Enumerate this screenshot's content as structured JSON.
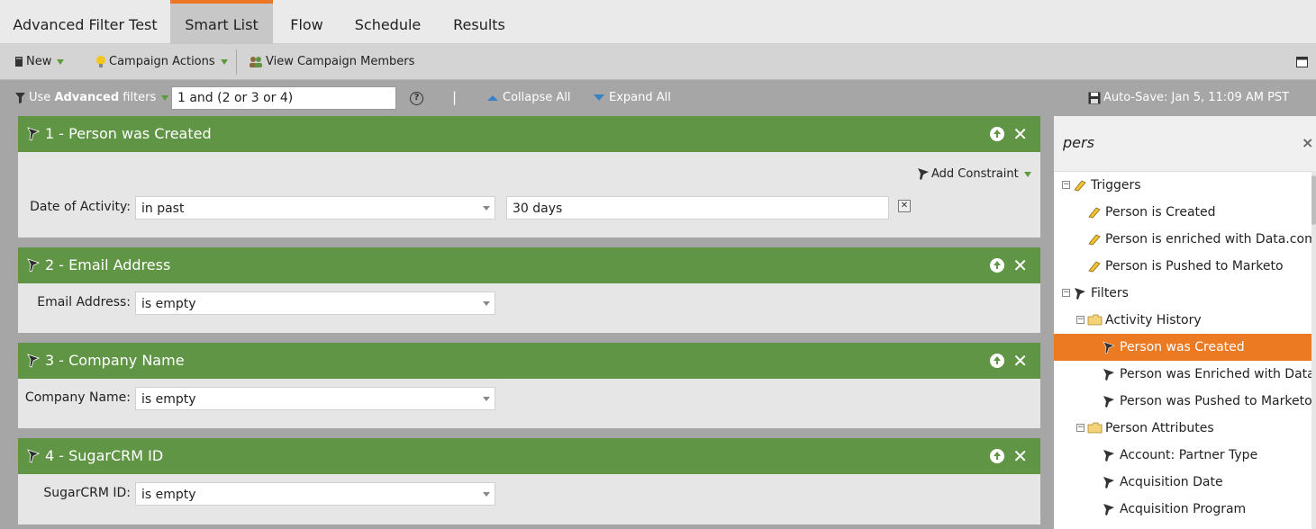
{
  "tabs": [
    {
      "label": "Advanced Filter Test"
    },
    {
      "label": "Smart List"
    },
    {
      "label": "Flow"
    },
    {
      "label": "Schedule"
    },
    {
      "label": "Results"
    }
  ],
  "active_tab": "Smart List",
  "toolbar": {
    "new_label": "New",
    "campaign_actions_label": "Campaign Actions",
    "view_members_label": "View Campaign Members"
  },
  "filterbar": {
    "use_label": "Use",
    "advanced_label": "Advanced",
    "filters_label": "filters",
    "logic_value": "1 and (2 or 3 or 4)",
    "help_label": "?",
    "separator": "|",
    "collapse_label": "Collapse All",
    "expand_label": "Expand All",
    "autosave_label": "Auto-Save: Jan 5, 11:09 AM PST"
  },
  "filters": [
    {
      "title": "1 - Person was Created",
      "add_constraint_label": "Add Constraint",
      "field_label": "Date of Activity:",
      "operator": "in past",
      "value": "30 days"
    },
    {
      "title": "2 - Email Address",
      "field_label": "Email Address:",
      "operator": "is empty"
    },
    {
      "title": "3 - Company Name",
      "field_label": "Company Name:",
      "operator": "is empty"
    },
    {
      "title": "4 - SugarCRM ID",
      "field_label": "SugarCRM ID:",
      "operator": "is empty"
    }
  ],
  "panel": {
    "search_value": "pers",
    "close_label": "×",
    "tree": [
      {
        "label": "Triggers",
        "type": "group-trigger"
      },
      {
        "label": "Person is Created",
        "type": "trigger"
      },
      {
        "label": "Person is enriched with Data.com",
        "type": "trigger"
      },
      {
        "label": "Person is Pushed to Marketo",
        "type": "trigger"
      },
      {
        "label": "Filters",
        "type": "group-filter"
      },
      {
        "label": "Activity History",
        "type": "folder"
      },
      {
        "label": "Person was Created",
        "type": "filter",
        "selected": true
      },
      {
        "label": "Person was Enriched with Data.c",
        "type": "filter"
      },
      {
        "label": "Person was Pushed to Marketo",
        "type": "filter"
      },
      {
        "label": "Person Attributes",
        "type": "folder"
      },
      {
        "label": "Account: Partner Type",
        "type": "filter"
      },
      {
        "label": "Acquisition Date",
        "type": "filter"
      },
      {
        "label": "Acquisition Program",
        "type": "filter"
      }
    ]
  },
  "colors": {
    "accent_orange": "#ec7a22",
    "header_green": "#5f9545",
    "link_blue": "#3a82c4"
  }
}
